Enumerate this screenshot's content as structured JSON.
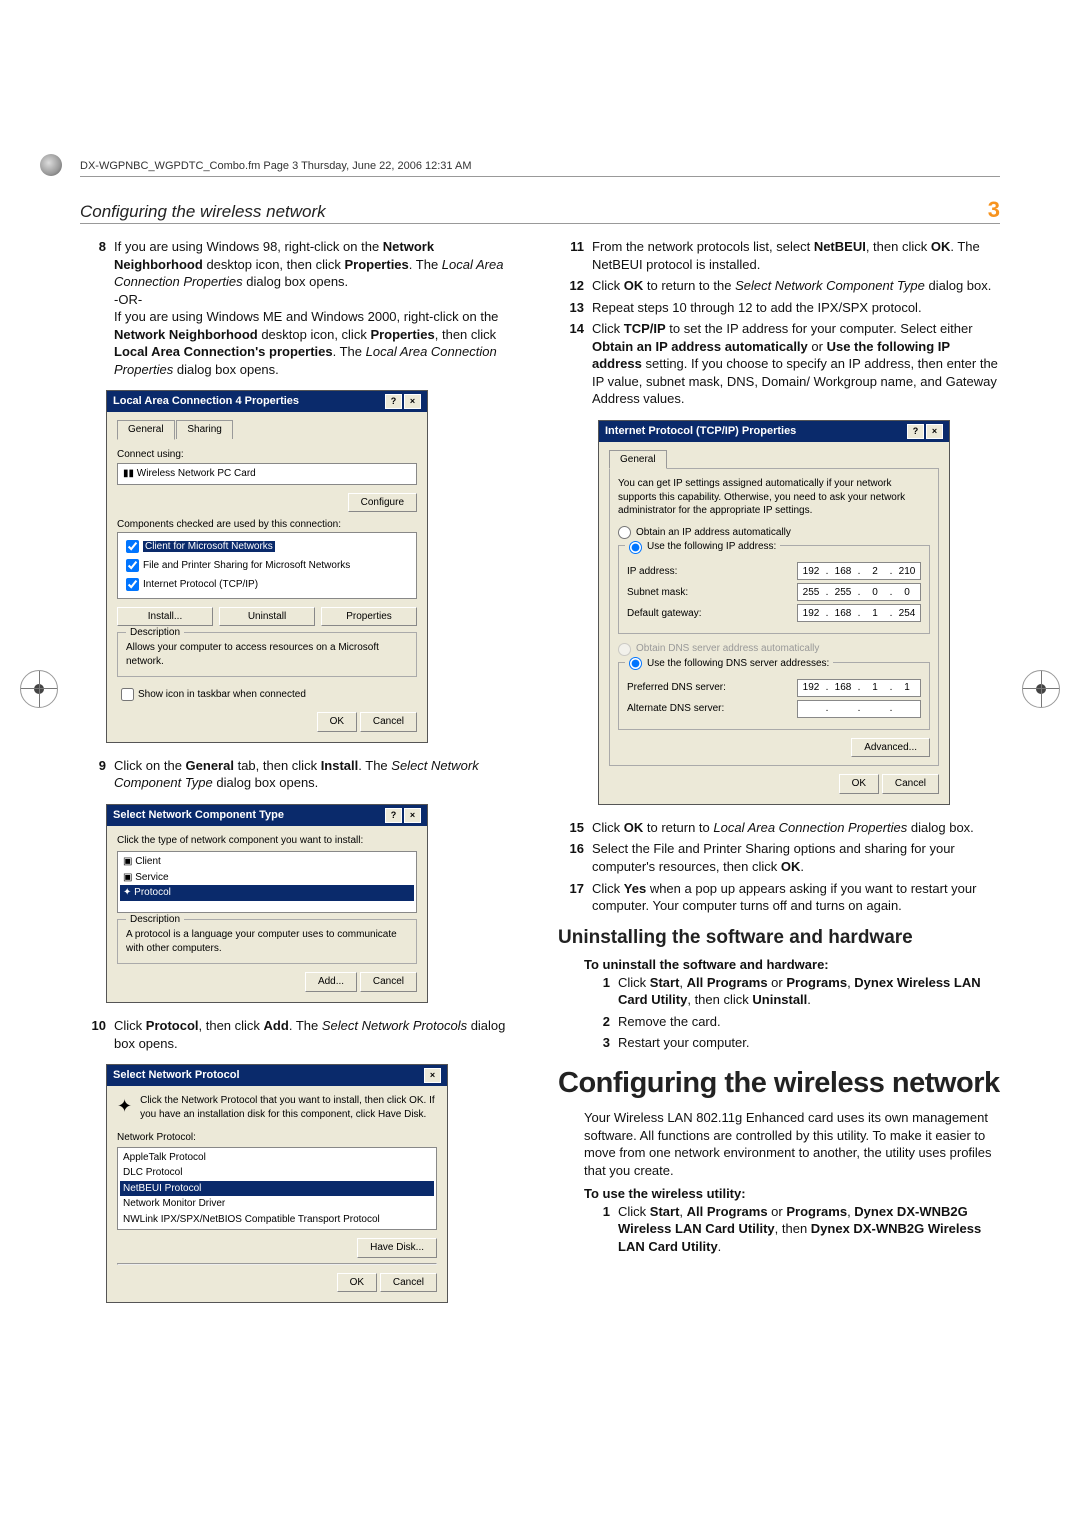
{
  "header_file_info": "DX-WGPNBC_WGPDTC_Combo.fm  Page 3  Thursday, June 22, 2006  12:31 AM",
  "breadcrumb": "Configuring the wireless network",
  "page_number": "3",
  "left": {
    "s8_a": "If you are using Windows 98, right-click on the ",
    "s8_b": "Network Neighborhood",
    "s8_c": " desktop icon, then click ",
    "s8_d": "Properties",
    "s8_e": ". The ",
    "s8_f": "Local Area Connection Properties",
    "s8_g": " dialog box opens.",
    "or": "-OR-",
    "s8_h": "If you are using Windows ME and Windows 2000, right-click on the ",
    "s8_i": "Network Neighborhood",
    "s8_j": " desktop icon, click ",
    "s8_k": "Properties",
    "s8_l": ", then click ",
    "s8_m": "Local Area Connection's properties",
    "s8_n": ". The ",
    "s8_o": "Local Area Connection Properties",
    "s8_p": " dialog box opens.",
    "s9_a": "Click on the ",
    "s9_b": "General",
    "s9_c": " tab, then click ",
    "s9_d": "Install",
    "s9_e": ". The ",
    "s9_f": "Select Network Component Type",
    "s9_g": " dialog box opens.",
    "s10_a": "Click ",
    "s10_b": "Protocol",
    "s10_c": ", then click ",
    "s10_d": "Add",
    "s10_e": ". The ",
    "s10_f": "Select Network Protocols",
    "s10_g": " dialog box opens."
  },
  "dlg_lac": {
    "title": "Local Area Connection 4 Properties",
    "tab_general": "General",
    "tab_sharing": "Sharing",
    "connect_using": "Connect using:",
    "adapter": "Wireless Network PC Card",
    "configure": "Configure",
    "components_label": "Components checked are used by this connection:",
    "comp1": "Client for Microsoft Networks",
    "comp2": "File and Printer Sharing for Microsoft Networks",
    "comp3": "Internet Protocol (TCP/IP)",
    "install": "Install...",
    "uninstall": "Uninstall",
    "properties": "Properties",
    "desc_header": "Description",
    "desc_text": "Allows your computer to access resources on a Microsoft network.",
    "show_icon": "Show icon in taskbar when connected",
    "ok": "OK",
    "cancel": "Cancel"
  },
  "dlg_snct": {
    "title": "Select Network Component Type",
    "prompt": "Click the type of network component you want to install:",
    "client": "Client",
    "service": "Service",
    "protocol": "Protocol",
    "desc_header": "Description",
    "desc_text": "A protocol is a language your computer uses to communicate with other computers.",
    "add": "Add...",
    "cancel": "Cancel"
  },
  "dlg_snp": {
    "title": "Select Network Protocol",
    "prompt": "Click the Network Protocol that you want to install, then click OK. If you have an installation disk for this component, click Have Disk.",
    "list_label": "Network Protocol:",
    "p1": "AppleTalk Protocol",
    "p2": "DLC Protocol",
    "p3": "NetBEUI Protocol",
    "p4": "Network Monitor Driver",
    "p5": "NWLink IPX/SPX/NetBIOS Compatible Transport Protocol",
    "have_disk": "Have Disk...",
    "ok": "OK",
    "cancel": "Cancel"
  },
  "right": {
    "s11_a": "From the network protocols list, select ",
    "s11_b": "NetBEUI",
    "s11_c": ", then click ",
    "s11_d": "OK",
    "s11_e": ". The NetBEUI protocol is installed.",
    "s12_a": "Click ",
    "s12_b": "OK",
    "s12_c": " to return to the ",
    "s12_d": "Select Network Component Type",
    "s12_e": " dialog box.",
    "s13": "Repeat steps 10 through 12 to add the IPX/SPX protocol.",
    "s14_a": "Click ",
    "s14_b": "TCP/IP",
    "s14_c": " to set the IP address for your computer. Select either ",
    "s14_d": "Obtain an IP address automatically",
    "s14_e": " or ",
    "s14_f": "Use the following IP address",
    "s14_g": " setting. If you choose to specify an IP address, then enter the IP value, subnet mask, DNS, Domain/ Workgroup name, and Gateway Address values.",
    "s15_a": "Click ",
    "s15_b": "OK",
    "s15_c": " to return to ",
    "s15_d": "Local Area Connection Properties",
    "s15_e": " dialog box.",
    "s16_a": "Select the File and Printer Sharing options and sharing for your computer's resources, then click ",
    "s16_b": "OK",
    "s16_c": ".",
    "s17_a": "Click ",
    "s17_b": "Yes",
    "s17_c": " when a pop up appears asking if you want to restart your computer. Your computer turns off and turns on again.",
    "h2": "Uninstalling the software and hardware",
    "sub1": "To uninstall the software and hardware:",
    "u1_a": "Click ",
    "u1_b": "Start",
    "u1_c": ", ",
    "u1_d": "All Programs",
    "u1_e": " or ",
    "u1_f": "Programs",
    "u1_g": ", ",
    "u1_h": "Dynex Wireless LAN Card Utility",
    "u1_i": ", then click ",
    "u1_j": "Uninstall",
    "u1_k": ".",
    "u2": "Remove the card.",
    "u3": "Restart your computer.",
    "h1": "Configuring the wireless network",
    "intro": "Your Wireless LAN 802.11g Enhanced card uses its own management software. All functions are controlled by this utility. To make it easier to move from one network environment to another, the utility uses profiles that you create.",
    "sub2": "To use the wireless utility:",
    "w1_a": "Click ",
    "w1_b": "Start",
    "w1_c": ", ",
    "w1_d": "All Programs",
    "w1_e": " or ",
    "w1_f": "Programs",
    "w1_g": ", ",
    "w1_h": "Dynex DX-WNB2G Wireless LAN Card Utility",
    "w1_i": ", then ",
    "w1_j": "Dynex DX-WNB2G Wireless LAN Card Utility",
    "w1_k": "."
  },
  "dlg_tcp": {
    "title": "Internet Protocol (TCP/IP) Properties",
    "tab_general": "General",
    "intro": "You can get IP settings assigned automatically if your network supports this capability. Otherwise, you need to ask your network administrator for the appropriate IP settings.",
    "r1": "Obtain an IP address automatically",
    "r2": "Use the following IP address:",
    "ip_label": "IP address:",
    "subnet_label": "Subnet mask:",
    "gateway_label": "Default gateway:",
    "r3": "Obtain DNS server address automatically",
    "r4": "Use the following DNS server addresses:",
    "pref_dns": "Preferred DNS server:",
    "alt_dns": "Alternate DNS server:",
    "advanced": "Advanced...",
    "ok": "OK",
    "cancel": "Cancel",
    "ip": [
      "192",
      "168",
      "2",
      "210"
    ],
    "mask": [
      "255",
      "255",
      "0",
      "0"
    ],
    "gw": [
      "192",
      "168",
      "1",
      "254"
    ],
    "dns1": [
      "192",
      "168",
      "1",
      "1"
    ],
    "dns2": [
      "",
      "",
      "",
      ""
    ]
  }
}
